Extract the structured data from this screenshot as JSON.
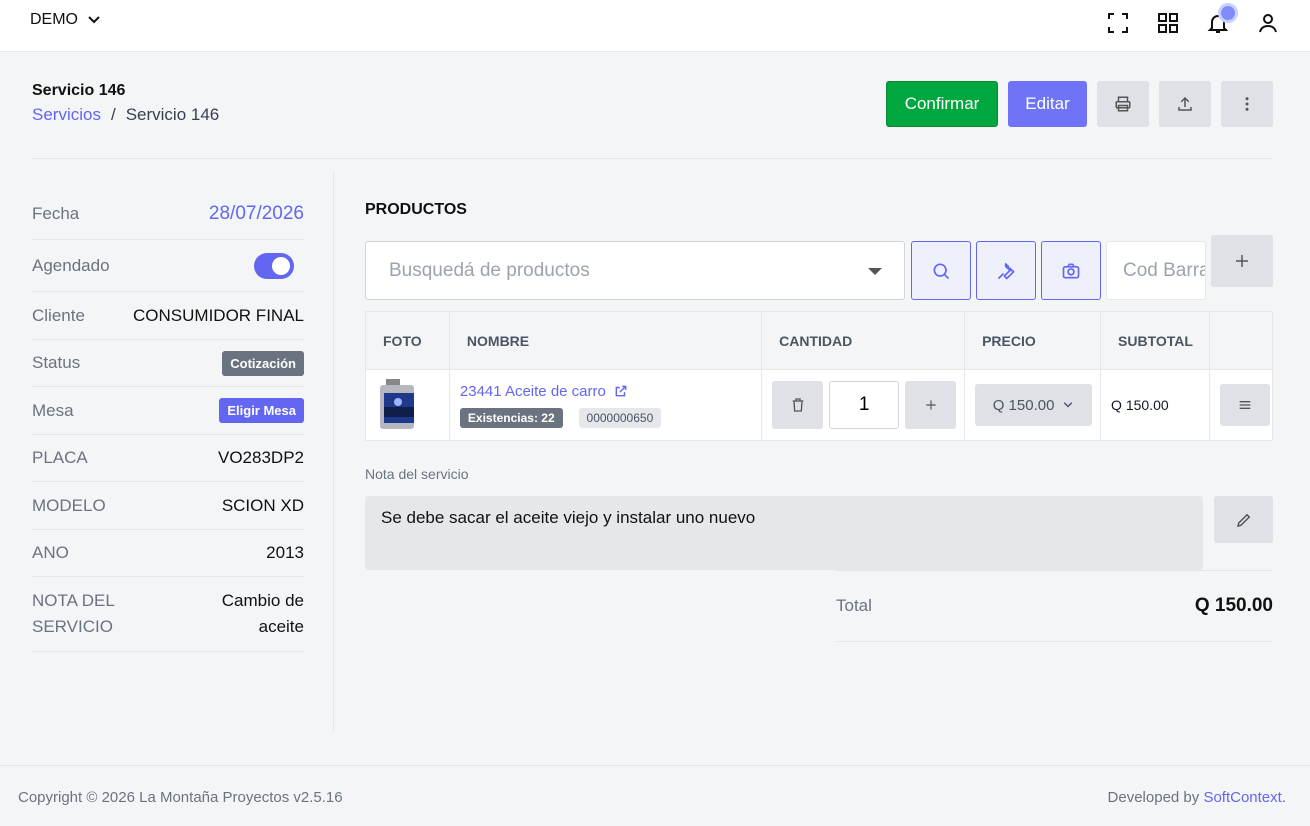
{
  "topbar": {
    "company": "DEMO",
    "icons": [
      "fullscreen-icon",
      "apps-grid-icon",
      "bell-icon",
      "user-icon"
    ]
  },
  "header": {
    "title": "Servicio 146",
    "breadcrumb": {
      "parent": "Servicios",
      "separator": "/",
      "current": "Servicio 146"
    },
    "buttons": {
      "confirm": "Confirmar",
      "edit": "Editar"
    },
    "action_icons": [
      "printer-icon",
      "upload-icon",
      "more-vertical-icon"
    ]
  },
  "details": {
    "fecha": {
      "label": "Fecha",
      "value": "28/07/2026"
    },
    "agendado": {
      "label": "Agendado",
      "on": true
    },
    "cliente": {
      "label": "Cliente",
      "value": "CONSUMIDOR FINAL"
    },
    "status": {
      "label": "Status",
      "value": "Cotización"
    },
    "mesa": {
      "label": "Mesa",
      "value": "Eligir Mesa"
    },
    "placa": {
      "label": "PLACA",
      "value": "VO283DP2"
    },
    "modelo": {
      "label": "MODELO",
      "value": "SCION XD"
    },
    "ano": {
      "label": "ANO",
      "value": "2013"
    },
    "nota": {
      "label": "NOTA DEL SERVICIO",
      "value": "Cambio de aceite"
    }
  },
  "products": {
    "title": "PRODUCTOS",
    "search_placeholder": "Busquedá de productos",
    "barcode_placeholder": "Cod Barra",
    "columns": [
      "FOTO",
      "NOMBRE",
      "CANTIDAD",
      "PRECIO",
      "SUBTOTAL",
      ""
    ],
    "rows": [
      {
        "name": "23441 Aceite de carro",
        "stock": "Existencias: 22",
        "code": "0000000650",
        "quantity": "1",
        "price": "Q 150.00",
        "subtotal": "Q 150.00"
      }
    ]
  },
  "note": {
    "label": "Nota del servicio",
    "text": "Se debe sacar el aceite viejo y instalar uno nuevo"
  },
  "totals": {
    "label": "Total",
    "value": "Q 150.00"
  },
  "footer": {
    "copyright": "Copyright © 2026 La Montaña Proyectos v2.5.16",
    "developed_prefix": "Developed by",
    "developer": "SoftContext",
    "developed_suffix": "."
  },
  "colors": {
    "accent": "#6366f1",
    "confirm": "#00a63e",
    "neutral_button": "#dfe1e6"
  }
}
